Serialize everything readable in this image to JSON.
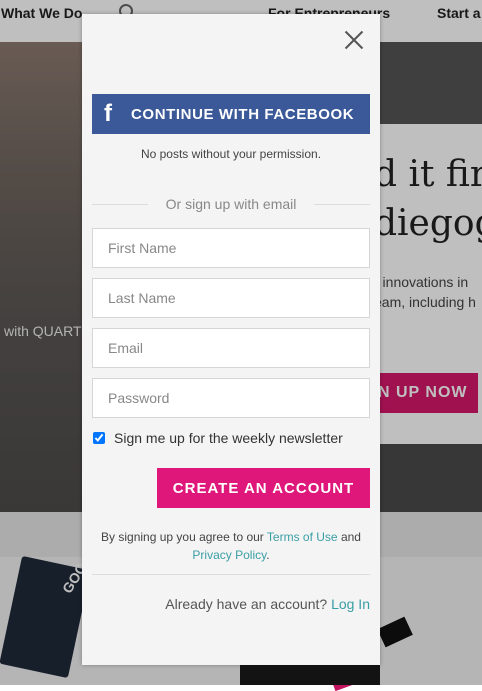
{
  "background": {
    "nav_left": "What We Do",
    "nav_mid": "For Entrepreneurs",
    "nav_right": "Start a",
    "headline_1": "d it fir",
    "headline_2": "diegog",
    "body_1": "r innovations in",
    "body_2": "eam, including h",
    "left_text": "with QUART",
    "signup_button": "N UP NOW",
    "book_text": "GOO"
  },
  "modal": {
    "facebook_button": "CONTINUE WITH FACEBOOK",
    "facebook_icon": "f",
    "facebook_note": "No posts without your permission.",
    "divider_text": "Or sign up with email",
    "first_name_placeholder": "First Name",
    "last_name_placeholder": "Last Name",
    "email_placeholder": "Email",
    "password_placeholder": "Password",
    "newsletter_label": "Sign me up for the weekly newsletter",
    "newsletter_checked": true,
    "create_button": "CREATE AN ACCOUNT",
    "terms_prefix": "By signing up you agree to our",
    "terms_link": "Terms of Use",
    "terms_and": "and",
    "privacy_link": "Privacy Policy",
    "terms_suffix": ".",
    "login_prompt": "Already have an account?",
    "login_link": "Log In"
  },
  "colors": {
    "facebook": "#3b5998",
    "accent_pink": "#e0177a",
    "link_teal": "#3a9ea5"
  }
}
